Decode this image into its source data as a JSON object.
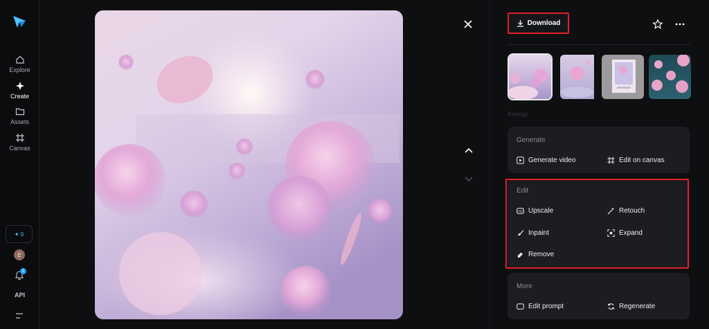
{
  "sidebar": {
    "items": [
      {
        "label": "Explore",
        "icon": "home-icon"
      },
      {
        "label": "Create",
        "icon": "sparkle-icon",
        "active": true
      },
      {
        "label": "Assets",
        "icon": "folder-icon"
      },
      {
        "label": "Canvas",
        "icon": "canvas-icon"
      }
    ],
    "credits": "0",
    "avatar_initial": "E",
    "notification_count": "1",
    "api_label": "API"
  },
  "viewer": {
    "image": "pink cotton-candy clouds floating in a pastel lavender sky"
  },
  "panel": {
    "download_label": "Download",
    "faded_label": "Prompt",
    "generate": {
      "title": "Generate",
      "actions": [
        "Generate video",
        "Edit on canvas"
      ]
    },
    "edit": {
      "title": "Edit",
      "actions": [
        "Upscale",
        "Retouch",
        "Inpaint",
        "Expand",
        "Remove"
      ]
    },
    "more": {
      "title": "More",
      "actions": [
        "Edit prompt",
        "Regenerate"
      ]
    }
  },
  "colors": {
    "accent_highlight": "#e0202a",
    "background": "#0e0f11",
    "card": "#1c1d21",
    "credit_accent": "#4fd4f0"
  }
}
